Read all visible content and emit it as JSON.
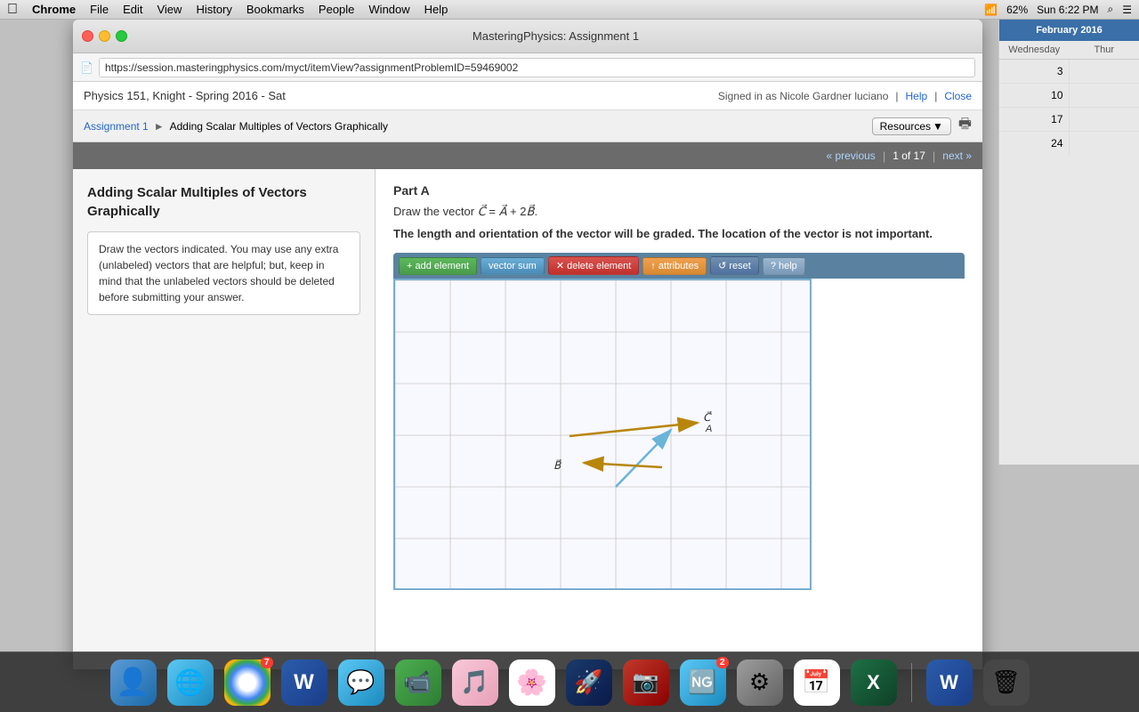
{
  "menubar": {
    "apple": "&#63743;",
    "items": [
      "Chrome",
      "File",
      "Edit",
      "View",
      "History",
      "Bookmarks",
      "People",
      "Window",
      "Help"
    ],
    "right": "Sun 6:22 PM"
  },
  "browser": {
    "title": "MasteringPhysics: Assignment 1",
    "url": "https://session.masteringphysics.com/myct/itemView?assignmentProblemID=59469002"
  },
  "site": {
    "course": "Physics 151, Knight - Spring 2016 - Sat",
    "signed_in": "Signed in as Nicole Gardner luciano",
    "help": "Help",
    "close": "Close"
  },
  "breadcrumb": {
    "assignment": "Assignment 1",
    "current": "Adding Scalar Multiples of Vectors Graphically",
    "resources": "Resources"
  },
  "navigation": {
    "previous": "« previous",
    "count": "1 of 17",
    "next": "next »"
  },
  "problem": {
    "title": "Adding Scalar Multiples of Vectors Graphically",
    "instructions": "Draw the vectors indicated. You may use any extra (unlabeled) vectors that are helpful; but, keep in mind that the unlabeled vectors should be deleted before submitting your answer."
  },
  "partA": {
    "label": "Part A",
    "equation": "Draw the vector C⃗ = A⃗ + 2B⃗.",
    "grading": "The length and orientation of the vector will be graded. The location of the vector is not important."
  },
  "toolbar": {
    "add_element": "+ add element",
    "vector_sum": "vector sum",
    "delete_element": "✕ delete element",
    "attributes": "↑ attributes",
    "reset": "↺ reset",
    "help": "? help"
  },
  "vectors": {
    "A_label": "C⃗",
    "A_sublabel": "A",
    "B_label": "B⃗"
  },
  "colors": {
    "accent_blue": "#2266cc",
    "nav_bar": "#6b6b6b",
    "toolbar_bg": "#5a82a0",
    "canvas_border": "#7aadcf",
    "vector_brown": "#b8860b",
    "vector_blue": "#6abadc",
    "submit_green": "#4a9a4a"
  }
}
